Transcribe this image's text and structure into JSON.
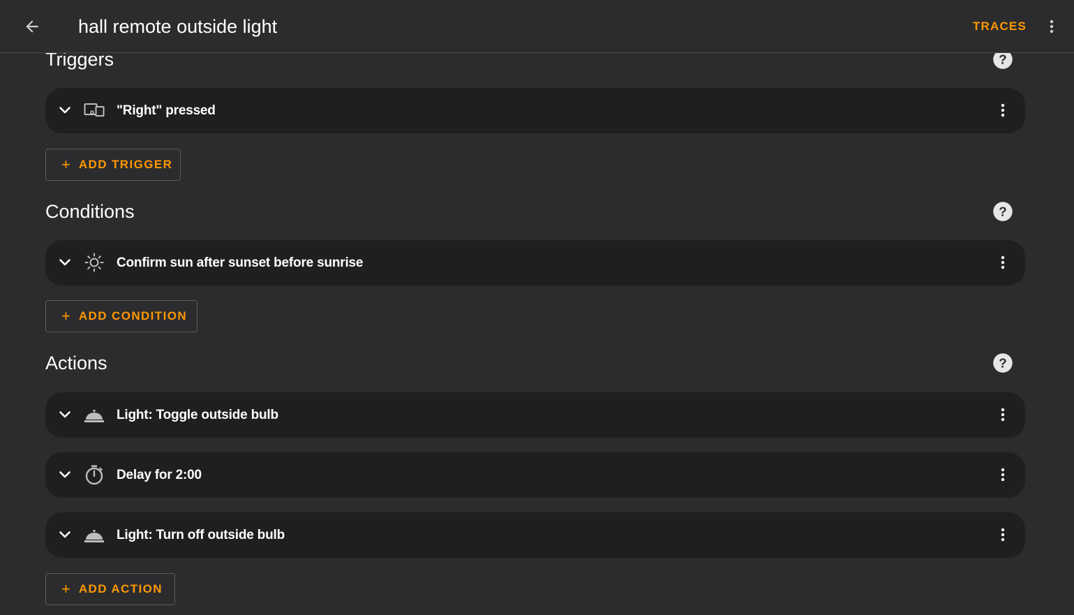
{
  "header": {
    "title": "hall remote outside light",
    "traces_label": "TRACES"
  },
  "triggers": {
    "title": "Triggers",
    "items": [
      {
        "label": "\"Right\" pressed",
        "icon": "device-icon"
      }
    ],
    "add_label": "ADD TRIGGER"
  },
  "conditions": {
    "title": "Conditions",
    "items": [
      {
        "label": "Confirm sun after sunset before sunrise",
        "icon": "sun-icon"
      }
    ],
    "add_label": "ADD CONDITION"
  },
  "actions": {
    "title": "Actions",
    "items": [
      {
        "label": "Light: Toggle outside bulb",
        "icon": "room-service-bell-icon"
      },
      {
        "label": "Delay for 2:00",
        "icon": "timer-icon"
      },
      {
        "label": "Light: Turn off outside bulb",
        "icon": "room-service-bell-icon"
      }
    ],
    "add_label": "ADD ACTION"
  },
  "colors": {
    "accent": "#ff9800",
    "background": "#2c2c2e",
    "card": "#1f1f21"
  }
}
